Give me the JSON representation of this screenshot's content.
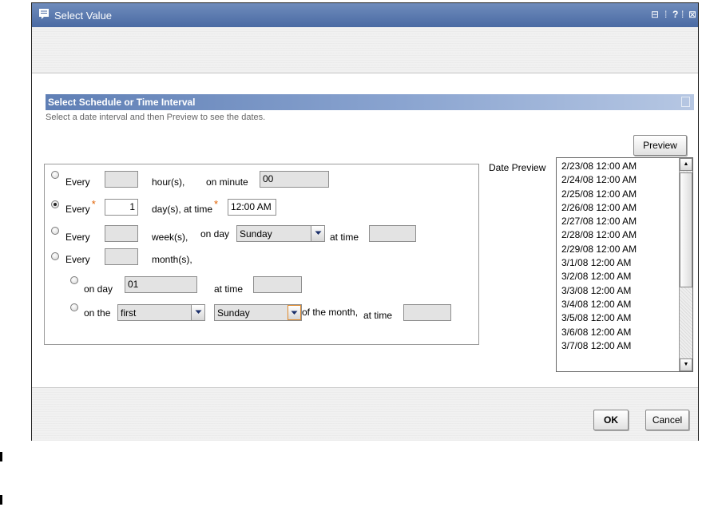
{
  "window": {
    "title": "Select Value",
    "controls": {
      "minimize": "⊟",
      "sep1": "⁞",
      "help": "?",
      "sep2": "⁞",
      "close": "⊠"
    }
  },
  "section": {
    "title": "Select Schedule or Time Interval",
    "description": "Select a date interval and then Preview to see the dates."
  },
  "preview_button": "Preview",
  "schedule": {
    "hours": {
      "every": "Every",
      "value": "",
      "unit": "hour(s),",
      "minute_label": "on minute",
      "minute": "00"
    },
    "days": {
      "every": "Every",
      "required": "*",
      "value": "1",
      "unit": "day(s), at time",
      "time": "12:00 AM"
    },
    "weeks": {
      "every": "Every",
      "value": "",
      "unit": "week(s),",
      "day_label": "on day",
      "day": "Sunday",
      "time_label": "at time",
      "time": ""
    },
    "months": {
      "every": "Every",
      "value": "",
      "unit": "month(s),",
      "on_day": {
        "label": "on day",
        "value": "01",
        "time_label": "at time",
        "time": ""
      },
      "on_the": {
        "label": "on the",
        "ordinal": "first",
        "weekday": "Sunday",
        "suffix": "of the month,",
        "time_label": "at time",
        "time": ""
      }
    },
    "selected": "days"
  },
  "date_preview": {
    "label": "Date Preview",
    "items": [
      "2/23/08 12:00 AM",
      "2/24/08 12:00 AM",
      "2/25/08 12:00 AM",
      "2/26/08 12:00 AM",
      "2/27/08 12:00 AM",
      "2/28/08 12:00 AM",
      "2/29/08 12:00 AM",
      "3/1/08 12:00 AM",
      "3/2/08 12:00 AM",
      "3/3/08 12:00 AM",
      "3/4/08 12:00 AM",
      "3/5/08 12:00 AM",
      "3/6/08 12:00 AM",
      "3/7/08 12:00 AM"
    ]
  },
  "footer": {
    "ok": "OK",
    "cancel": "Cancel"
  },
  "colors": {
    "title_bar": "#5674a8",
    "section_header": "#6d8bbf",
    "required": "#e06000"
  }
}
